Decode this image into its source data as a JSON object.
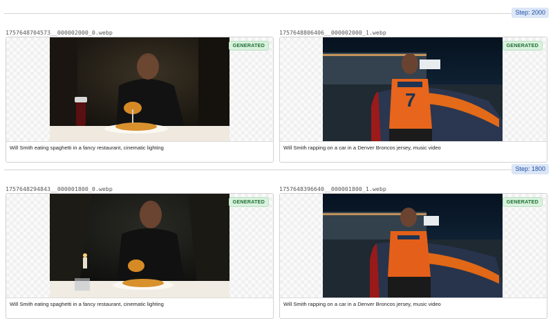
{
  "steps": [
    {
      "badge": "Step: 2000",
      "items": [
        {
          "filename": "1757648704573__000002000_0.webp",
          "status": "GENERATED",
          "caption": "Will Smith eating spaghetti in a fancy restaurant, cinematic lighting",
          "image_subject": "man-eating-spaghetti"
        },
        {
          "filename": "1757648806406__000002000_1.webp",
          "status": "GENERATED",
          "caption": "Will Smith rapping on a car in a Denver Broncos jersey, music video",
          "image_subject": "man-rapping-on-car"
        }
      ]
    },
    {
      "badge": "Step: 1800",
      "items": [
        {
          "filename": "1757648294843__000001800_0.webp",
          "status": "GENERATED",
          "caption": "Will Smith eating spaghetti in a fancy restaurant, cinematic lighting",
          "image_subject": "man-eating-spaghetti"
        },
        {
          "filename": "1757648396640__000001800_1.webp",
          "status": "GENERATED",
          "caption": "Will Smith rapping on a car in a Denver Broncos jersey, music video",
          "image_subject": "man-rapping-on-car"
        }
      ]
    }
  ]
}
